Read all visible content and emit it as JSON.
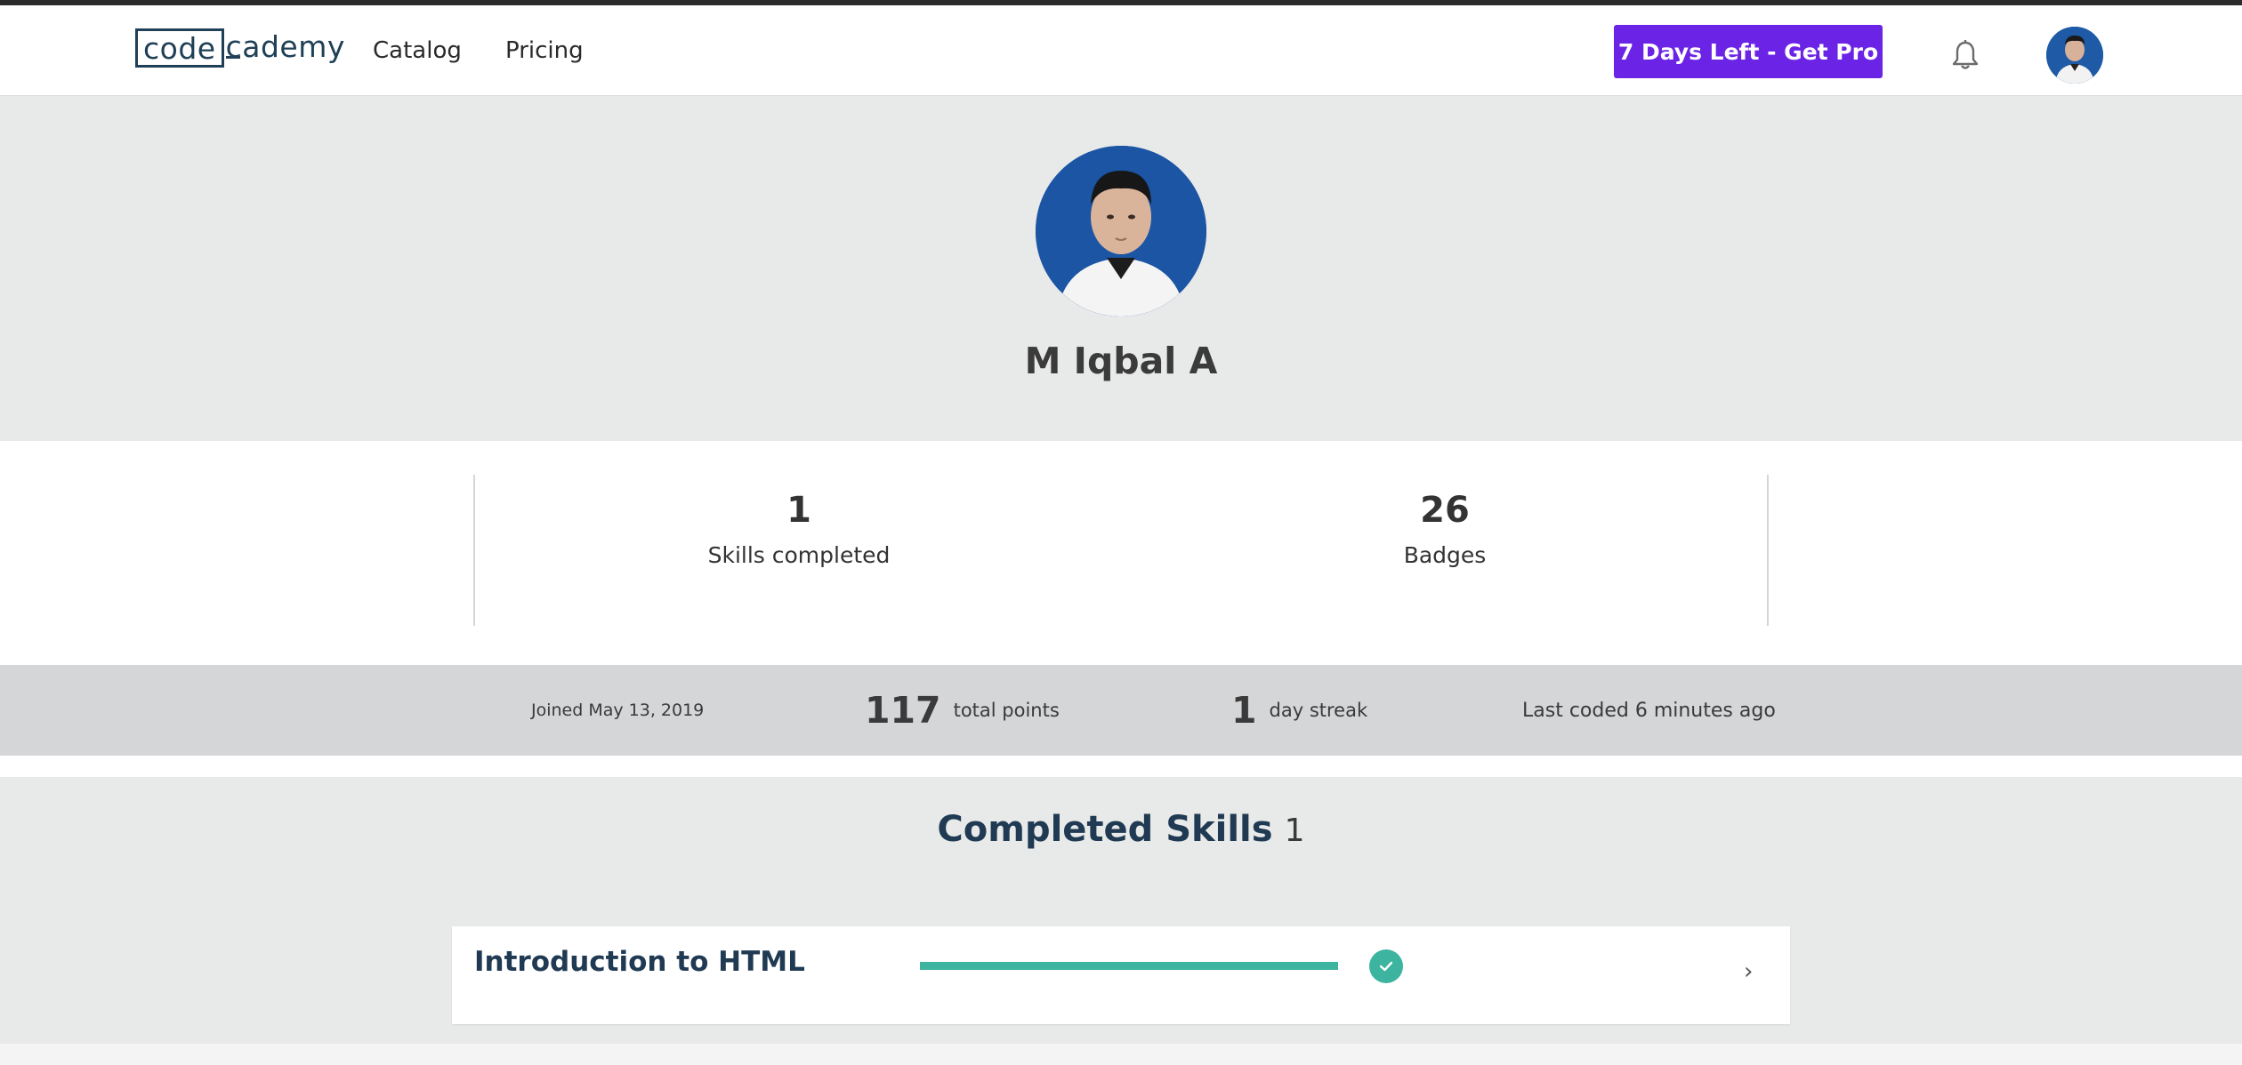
{
  "nav": {
    "logo_code": "code",
    "logo_rest": "cademy",
    "links": [
      {
        "label": "Catalog"
      },
      {
        "label": "Pricing"
      }
    ],
    "pro_button_label": "7 Days Left - Get Pro",
    "icons": {
      "notifications": "bell-icon",
      "avatar": "user-avatar"
    }
  },
  "profile": {
    "name": "M Iqbal A"
  },
  "stats": {
    "skills_completed_value": "1",
    "skills_completed_label": "Skills completed",
    "badges_value": "26",
    "badges_label": "Badges"
  },
  "meta": {
    "joined": "Joined May 13, 2019",
    "total_points_value": "117",
    "total_points_label": "total points",
    "streak_value": "1",
    "streak_label": "day streak",
    "last_coded": "Last coded 6 minutes ago"
  },
  "completed_skills": {
    "title": "Completed Skills",
    "count": "1",
    "items": [
      {
        "name": "Introduction to HTML",
        "progress": 1.0,
        "status_icon": "check-icon",
        "arrow_icon": "chevron-right-icon"
      }
    ]
  },
  "colors": {
    "brand": "#1f4056",
    "pro_button": "#6b23e6",
    "progress": "#3cb49f",
    "header_bg": "#e8e9e9",
    "meta_bg": "#d5d6d8"
  }
}
